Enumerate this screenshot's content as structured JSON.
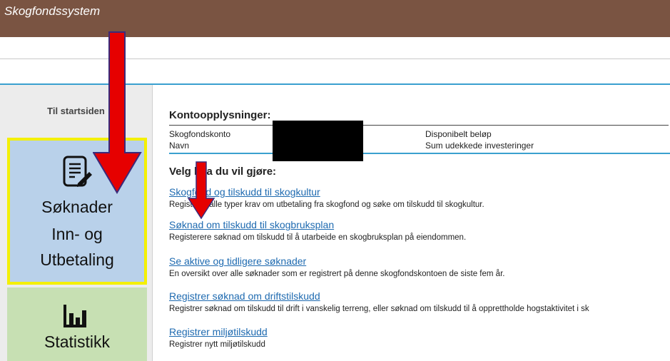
{
  "app": {
    "title": "Skogfondssystem"
  },
  "sidebar": {
    "start_label": "Til startsiden",
    "tile_soknad": {
      "icon": "form-edit-icon",
      "line1": "Søknader",
      "line2": "Inn- og",
      "line3": "Utbetaling"
    },
    "tile_statistikk": {
      "icon": "bar-chart-icon",
      "label": "Statistikk"
    }
  },
  "account": {
    "heading": "Kontoopplysninger:",
    "konto_label": "Skogfondskonto",
    "navn_label": "Navn",
    "disponibelt_label": "Disponibelt beløp",
    "udekkede_label": "Sum udekkede investeringer"
  },
  "choices": {
    "heading": "Velg hva du vil gjøre:",
    "items": [
      {
        "link": "Skogfond og tilskudd til skogkultur",
        "desc": "Registrere alle typer krav om utbetaling fra skogfond og søke om tilskudd til skogkultur."
      },
      {
        "link": "Søknad om tilskudd til skogbruksplan",
        "desc": "Registerere søknad om tilskudd til å utarbeide en skogbruksplan på eiendommen."
      },
      {
        "link": "Se aktive og tidligere søknader",
        "desc": "En oversikt over alle søknader som er registrert på denne skogfondskontoen de siste fem år."
      },
      {
        "link": "Registrer søknad om driftstilskudd",
        "desc": "Registrer søknad om tilskudd til drift i vanskelig terreng, eller søknad om tilskudd til å opprettholde hogstaktivitet i sk"
      },
      {
        "link": "Registrer miljøtilskudd",
        "desc": "Registrer nytt miljøtilskudd"
      }
    ]
  },
  "colors": {
    "header": "#7a5442",
    "accent": "#3aa0cf",
    "tile_blue": "#b9d1ea",
    "tile_green": "#c7e0b3",
    "highlight": "#f4f000",
    "arrow": "#e60000"
  }
}
